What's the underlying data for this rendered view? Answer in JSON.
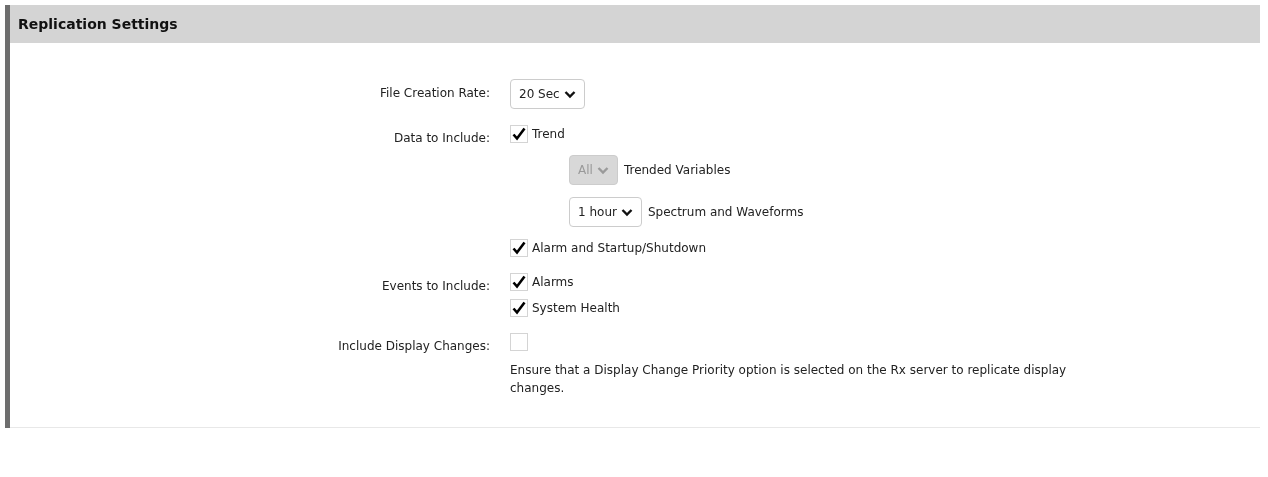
{
  "section": {
    "title": "Replication Settings"
  },
  "rows": [
    {
      "label": "File Creation Rate:",
      "items": [
        {
          "kind": "select",
          "value": "20 Sec",
          "disabled": false
        }
      ]
    },
    {
      "label": "Data to Include:",
      "items": [
        {
          "kind": "checkbox",
          "text": "Trend",
          "checked": true
        },
        {
          "kind": "sub_select",
          "value": "All",
          "text": "Trended Variables",
          "disabled": true
        },
        {
          "kind": "sub_select",
          "value": "1 hour",
          "text": "Spectrum and Waveforms",
          "disabled": false
        },
        {
          "kind": "checkbox",
          "text": "Alarm and Startup/Shutdown",
          "checked": true
        }
      ]
    },
    {
      "label": "Events to Include:",
      "items": [
        {
          "kind": "checkbox",
          "text": "Alarms",
          "checked": true
        },
        {
          "kind": "checkbox",
          "text": "System Health",
          "checked": true
        }
      ]
    },
    {
      "label": "Include Display Changes:",
      "items": [
        {
          "kind": "checkbox",
          "checked": false
        },
        {
          "kind": "note",
          "text": "Ensure that a Display Change Priority option is selected on the Rx server to replicate display changes."
        }
      ]
    }
  ]
}
